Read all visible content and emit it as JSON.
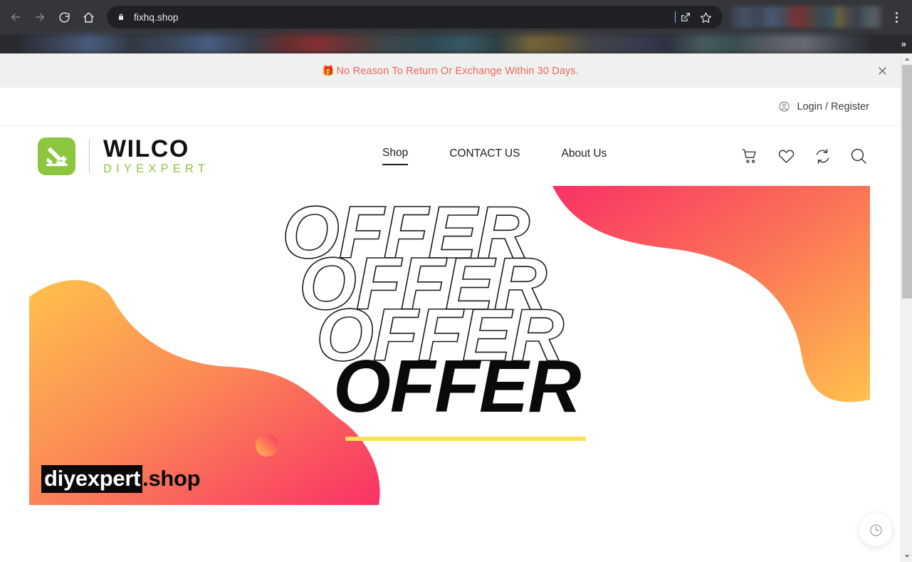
{
  "browser": {
    "url": "fixhq.shop",
    "back_label": "Back",
    "forward_label": "Forward",
    "reload_label": "Reload",
    "home_label": "Home",
    "share_label": "Share this page",
    "bookmark_label": "Bookmark this tab",
    "menu_label": "Customize and control Chrome",
    "bookmarks_overflow_label": "»"
  },
  "promo": {
    "emoji": "🎁",
    "text": "No Reason To Return Or Exchange Within 30 Days.",
    "close_label": "✕",
    "bg_color": "#f0f0f0",
    "text_color": "#e8695c"
  },
  "account": {
    "link_label": "Login / Register"
  },
  "header": {
    "logo": {
      "word": "WILCO",
      "sub": "DIYEXPERT",
      "mark_color": "#8cc63e",
      "sub_color": "#8cc63e"
    },
    "nav": [
      {
        "label": "Shop",
        "active": true
      },
      {
        "label": "CONTACT US",
        "active": false
      },
      {
        "label": "About Us",
        "active": false
      }
    ],
    "icons": [
      {
        "name": "cart",
        "label": "Cart"
      },
      {
        "name": "wishlist",
        "label": "Wishlist"
      },
      {
        "name": "compare",
        "label": "Compare"
      },
      {
        "name": "search",
        "label": "Search"
      }
    ]
  },
  "hero": {
    "offer_lines": [
      "OFFER",
      "OFFER",
      "OFFER",
      "OFFER"
    ],
    "brand_highlight": "diyexpert",
    "brand_domain": ".shop",
    "underline_color": "#fae053",
    "gradient_start": "#ffc14d",
    "gradient_mid": "#fb8055",
    "gradient_end": "#fa3166"
  },
  "widgets": {
    "recently_viewed_label": "Recently Viewed"
  }
}
